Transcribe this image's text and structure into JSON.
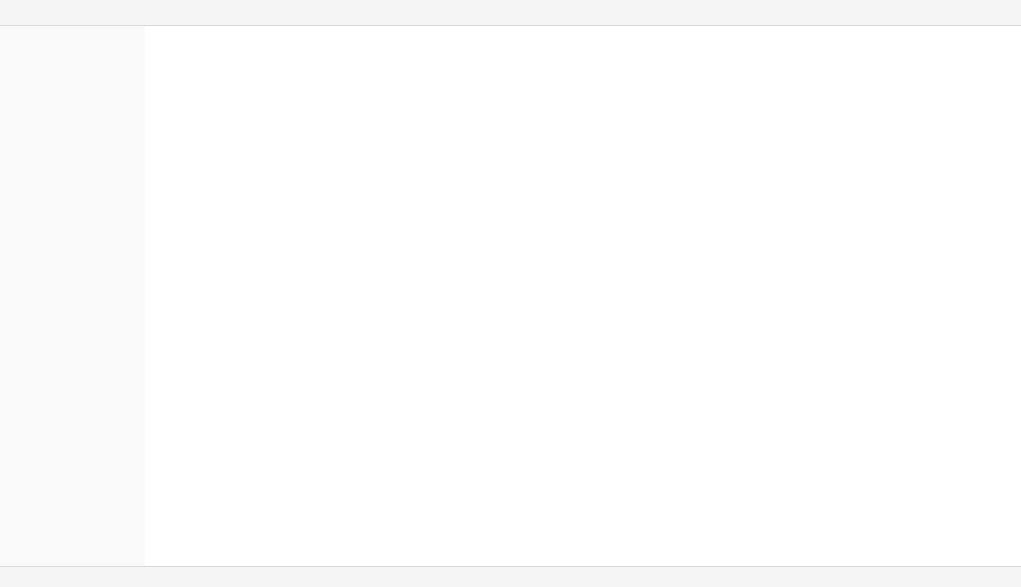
{
  "window": {
    "title": ""
  },
  "main": {
    "heading": ""
  },
  "status": {
    "text": ""
  }
}
